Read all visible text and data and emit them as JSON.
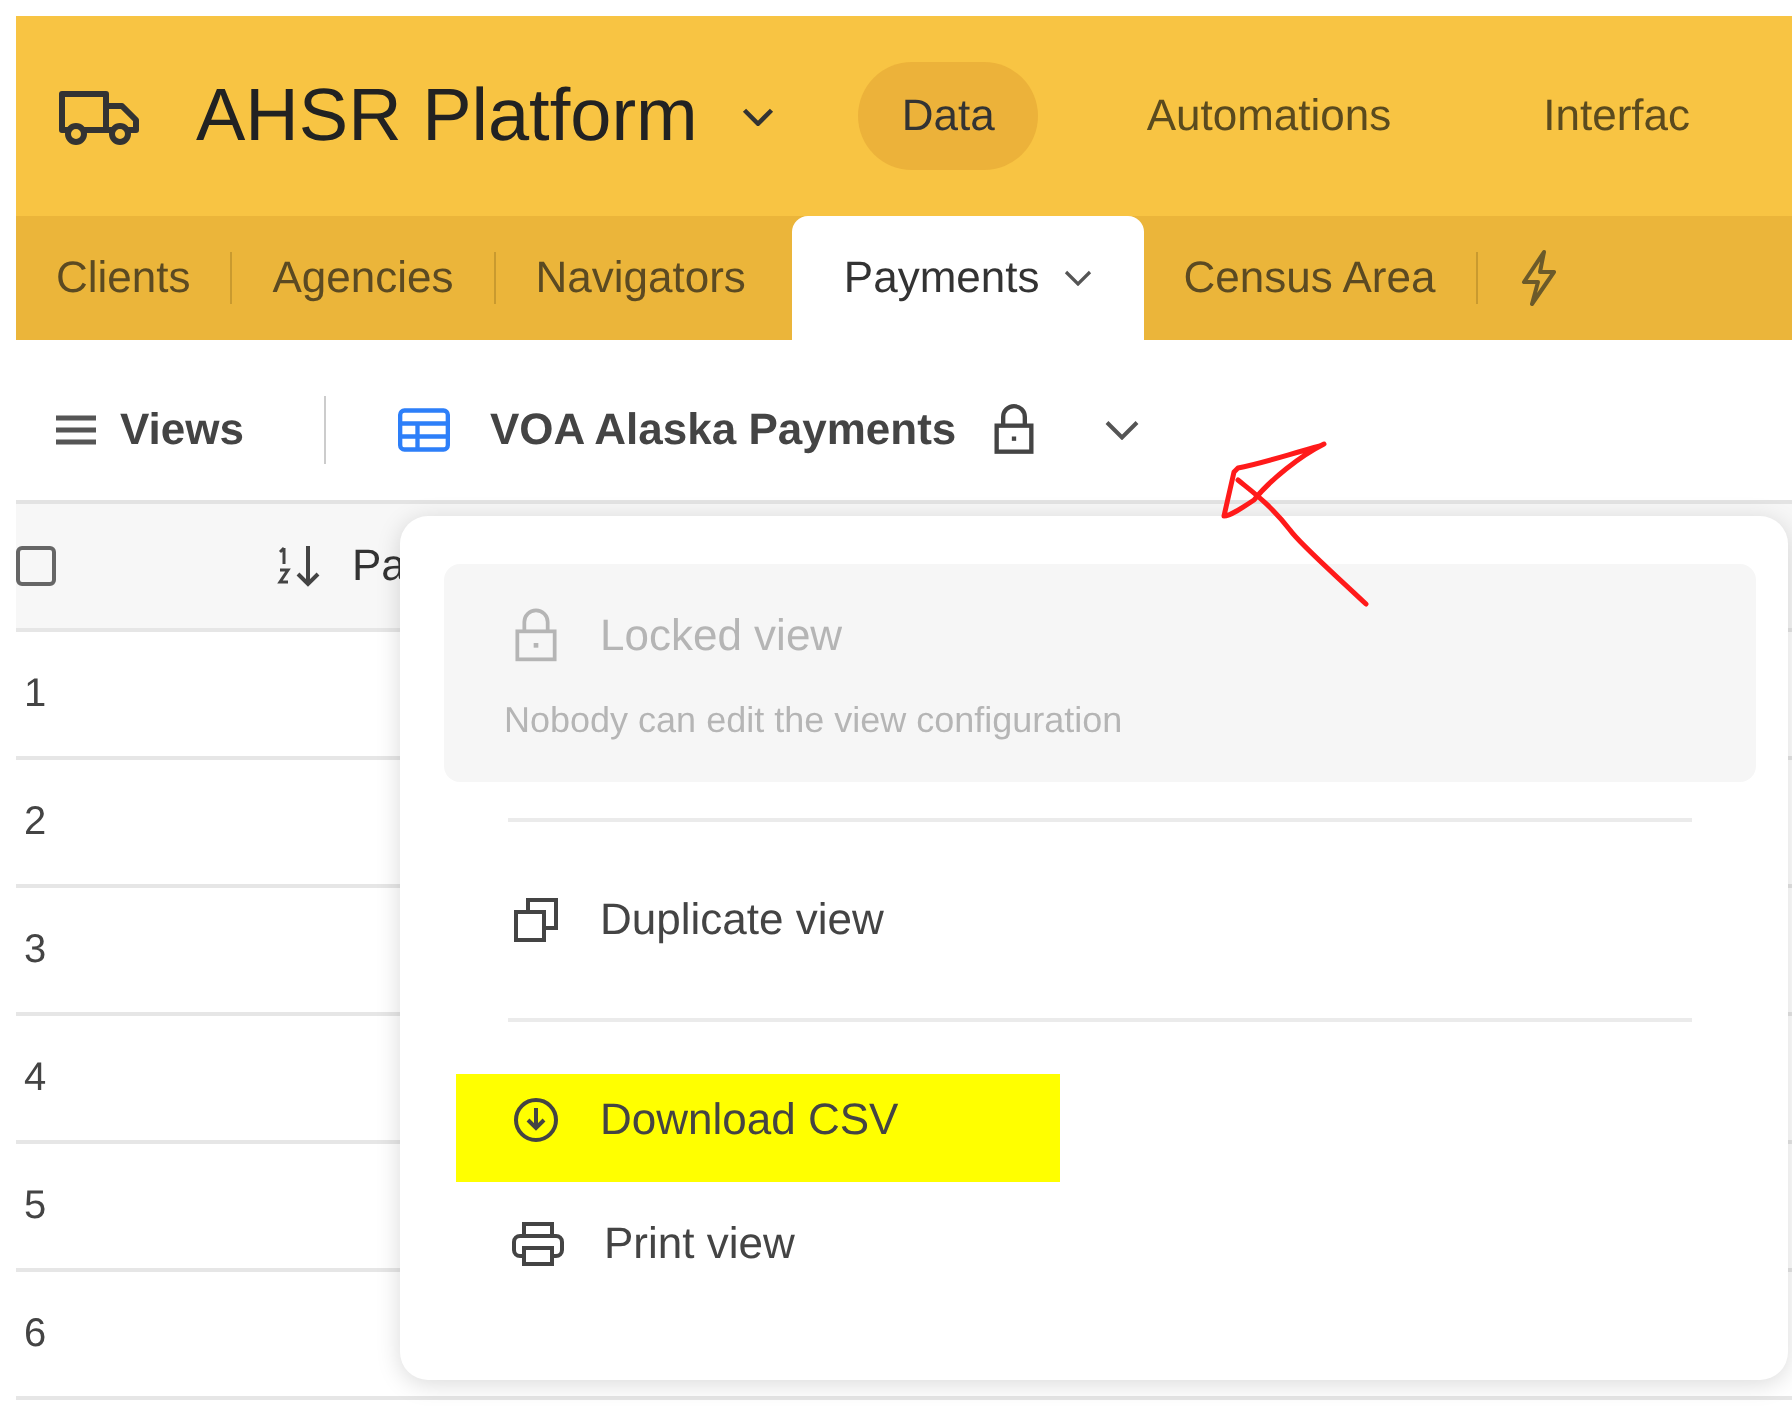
{
  "app": {
    "title": "AHSR Platform"
  },
  "nav": [
    {
      "label": "Data",
      "selected": true
    },
    {
      "label": "Automations",
      "selected": false
    },
    {
      "label": "Interfac",
      "selected": false
    }
  ],
  "tabs": [
    {
      "label": "Clients",
      "selected": false
    },
    {
      "label": "Agencies",
      "selected": false
    },
    {
      "label": "Navigators",
      "selected": false
    },
    {
      "label": "Payments",
      "selected": true
    },
    {
      "label": "Census Area",
      "selected": false
    }
  ],
  "toolbar": {
    "views_label": "Views",
    "view_name": "VOA Alaska Payments",
    "locked": true
  },
  "grid": {
    "select_all_checked": false,
    "column_1": "Pa",
    "rows": [
      "1",
      "2",
      "3",
      "4",
      "5",
      "6"
    ]
  },
  "menu": {
    "sections": [
      [
        {
          "kind": "locked",
          "label": "Locked view",
          "description": "Nobody can edit the view configuration",
          "disabled": true,
          "highlighted": false
        }
      ],
      [
        {
          "kind": "duplicate",
          "label": "Duplicate view",
          "disabled": false,
          "highlighted": false
        }
      ],
      [
        {
          "kind": "download",
          "label": "Download CSV",
          "disabled": false,
          "highlighted": true
        },
        {
          "kind": "print",
          "label": "Print view",
          "disabled": false,
          "highlighted": false
        }
      ]
    ]
  }
}
